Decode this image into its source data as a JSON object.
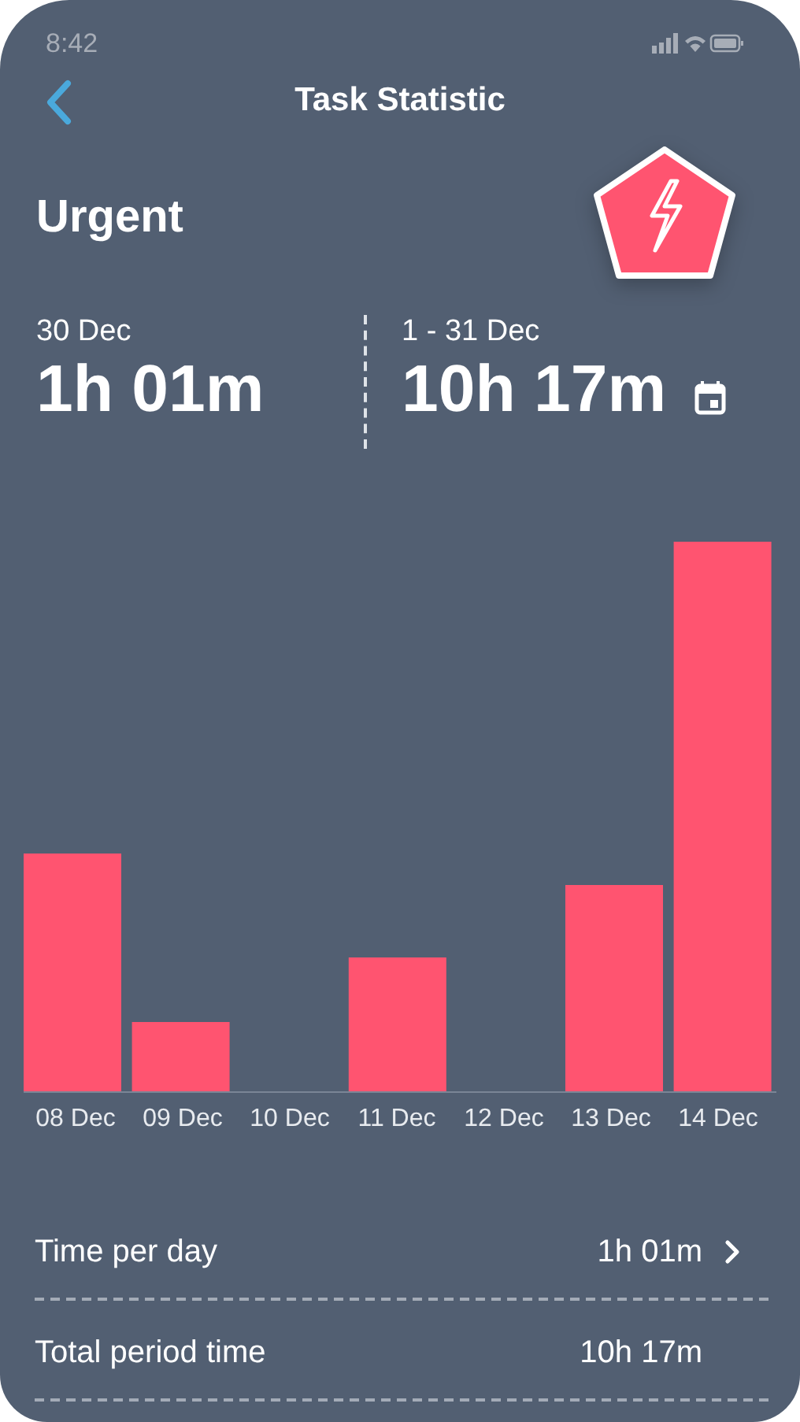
{
  "status_bar": {
    "time": "8:42"
  },
  "header": {
    "title": "Task Statistic"
  },
  "category": {
    "name": "Urgent"
  },
  "stats": [
    {
      "kind": "day",
      "period": "30 Dec",
      "duration": "1h 01m"
    },
    {
      "kind": "range",
      "period": "1 - 31 Dec",
      "duration": "10h 17m"
    }
  ],
  "chart": {
    "day_labels": [
      "08 Dec",
      "09 Dec",
      "10 Dec",
      "11 Dec",
      "12 Dec",
      "13 Dec",
      "14 Dec"
    ]
  },
  "summary": [
    {
      "label": "Time per day",
      "value": "1h 01m",
      "kind": "link"
    },
    {
      "label": "Total period time",
      "value": "10h 17m",
      "kind": "plain"
    }
  ]
}
